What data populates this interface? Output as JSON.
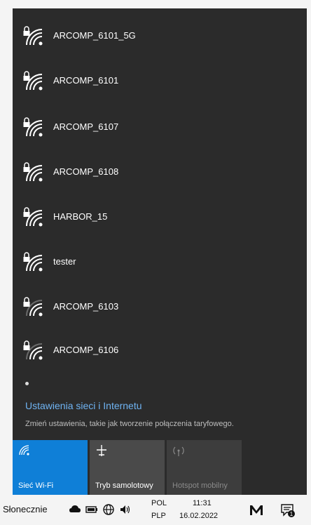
{
  "networks": [
    {
      "name": "ARCOMP_6101_5G",
      "secured": true,
      "signal": "full"
    },
    {
      "name": "ARCOMP_6101",
      "secured": true,
      "signal": "full"
    },
    {
      "name": "ARCOMP_6107",
      "secured": true,
      "signal": "full"
    },
    {
      "name": "ARCOMP_6108",
      "secured": true,
      "signal": "full"
    },
    {
      "name": "HARBOR_15",
      "secured": true,
      "signal": "full"
    },
    {
      "name": "tester",
      "secured": true,
      "signal": "full"
    },
    {
      "name": "ARCOMP_6103",
      "secured": true,
      "signal": "medium"
    },
    {
      "name": "ARCOMP_6106",
      "secured": true,
      "signal": "medium"
    }
  ],
  "settings": {
    "link_label": "Ustawienia sieci i Internetu",
    "description": "Zmień ustawienia, takie jak tworzenie połączenia taryfowego."
  },
  "tiles": {
    "wifi": {
      "label": "Sieć Wi-Fi",
      "state": "on"
    },
    "airplane": {
      "label": "Tryb samolotowy",
      "state": "off"
    },
    "hotspot": {
      "label": "Hotspot mobilny",
      "state": "disabled"
    }
  },
  "taskbar": {
    "weather": "Słonecznie",
    "lang_top": "POL",
    "lang_bottom": "PLP",
    "time": "11:31",
    "date": "16.02.2022",
    "notification_count": "1"
  },
  "colors": {
    "flyout_bg": "#2b2b2b",
    "accent": "#0f7fd7",
    "link": "#6fb3f2"
  },
  "icons": {
    "network": "wifi-secured-icon",
    "tile_wifi": "wifi-icon",
    "tile_airplane": "airplane-icon",
    "tile_hotspot": "hotspot-icon",
    "taskbar": [
      "cloud-icon",
      "battery-icon",
      "network-globe-icon",
      "volume-icon",
      "meet-icon",
      "notification-icon"
    ]
  }
}
